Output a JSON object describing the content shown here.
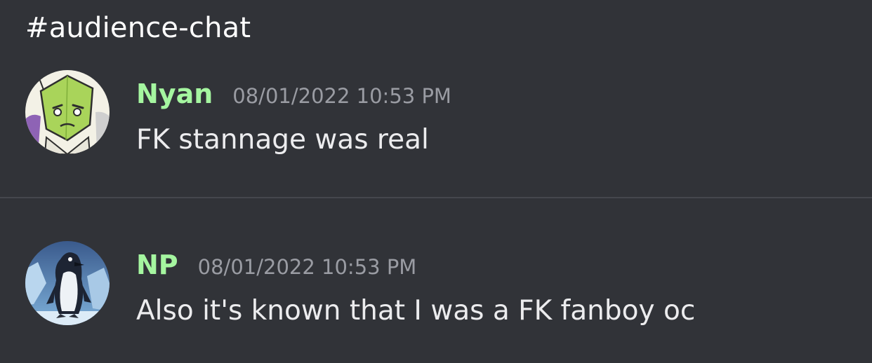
{
  "channel": {
    "title": "#audience-chat"
  },
  "messages": [
    {
      "username": "Nyan",
      "timestamp": "08/01/2022 10:53 PM",
      "content": "FK stannage was real",
      "avatar_icon": "peridot-avatar",
      "username_color": "#a5f6a0"
    },
    {
      "username": "NP",
      "timestamp": "08/01/2022 10:53 PM",
      "content": "Also it's known that I was a FK fanboy oc",
      "avatar_icon": "penguin-avatar",
      "username_color": "#a5f6a0"
    }
  ],
  "colors": {
    "background": "#313338",
    "divider": "#45474d",
    "timestamp": "#9a9ca3",
    "text": "#ececee"
  }
}
